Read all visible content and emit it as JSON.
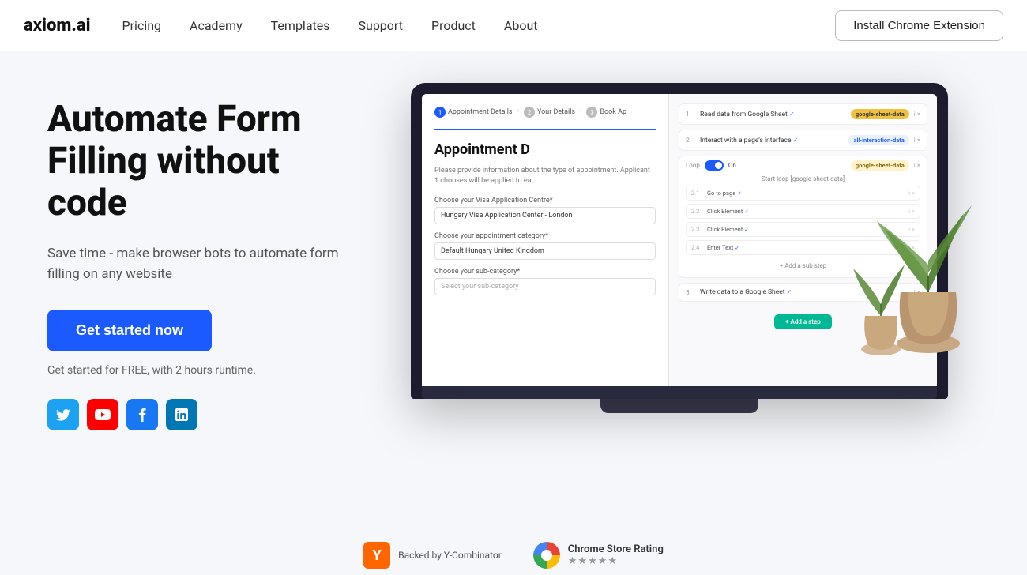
{
  "navbar": {
    "logo": "axiom.ai",
    "links": [
      {
        "label": "Pricing",
        "id": "pricing"
      },
      {
        "label": "Academy",
        "id": "academy"
      },
      {
        "label": "Templates",
        "id": "templates"
      },
      {
        "label": "Support",
        "id": "support"
      },
      {
        "label": "Product",
        "id": "product"
      },
      {
        "label": "About",
        "id": "about"
      }
    ],
    "cta_label": "Install Chrome Extension"
  },
  "hero": {
    "title": "Automate Form Filling without code",
    "subtitle": "Save time - make browser bots to automate form filling on any website",
    "cta_label": "Get started now",
    "free_text": "Get started for FREE, with 2 hours runtime.",
    "social": [
      {
        "label": "T",
        "name": "twitter",
        "title": "Twitter"
      },
      {
        "label": "▶",
        "name": "youtube",
        "title": "YouTube"
      },
      {
        "label": "f",
        "name": "facebook",
        "title": "Facebook"
      },
      {
        "label": "in",
        "name": "linkedin",
        "title": "LinkedIn"
      }
    ]
  },
  "laptop": {
    "form": {
      "steps": [
        "Appointment Details",
        "Your Details",
        "Book Ap"
      ],
      "title": "Appointment D",
      "description": "Please provide information about the type of appointment. Applicant 1 chooses will be applied to ea",
      "field1_label": "Choose your Visa Application Centre*",
      "field1_value": "Hungary Visa Application Center - London",
      "field2_label": "Choose your appointment category*",
      "field2_value": "Default Hungary United Kingdom",
      "field3_label": "Choose your sub-category*",
      "field3_placeholder": "Select your sub-category"
    },
    "workflow": {
      "items": [
        {
          "num": "1",
          "text": "Read data from Google Sheet",
          "badge": "google-sheet-data",
          "badge_type": "yellow"
        },
        {
          "num": "2",
          "text": "Interact with a page's interface",
          "badge": "all-interaction-data",
          "badge_type": "blue"
        },
        {
          "num": "loop",
          "text": "Loop On",
          "badge": "google-sheet-data",
          "badge_type": "yellow"
        },
        {
          "num": "2.1",
          "text": "Go to page"
        },
        {
          "num": "2.2",
          "text": "Click Element"
        },
        {
          "num": "2.3",
          "text": "Click Element"
        },
        {
          "num": "2.4",
          "text": "Enter Text"
        }
      ],
      "add_step_label": "+ Add a sub step",
      "bottom_step_label": "5",
      "bottom_step_text": "Write data to a Google Sheet",
      "bottom_cta": "+ Add a step"
    }
  },
  "footer": {
    "yc_label": "Backed by Y-Combinator",
    "chrome_label": "Chrome Store Rating",
    "stars": "★★★★★"
  }
}
